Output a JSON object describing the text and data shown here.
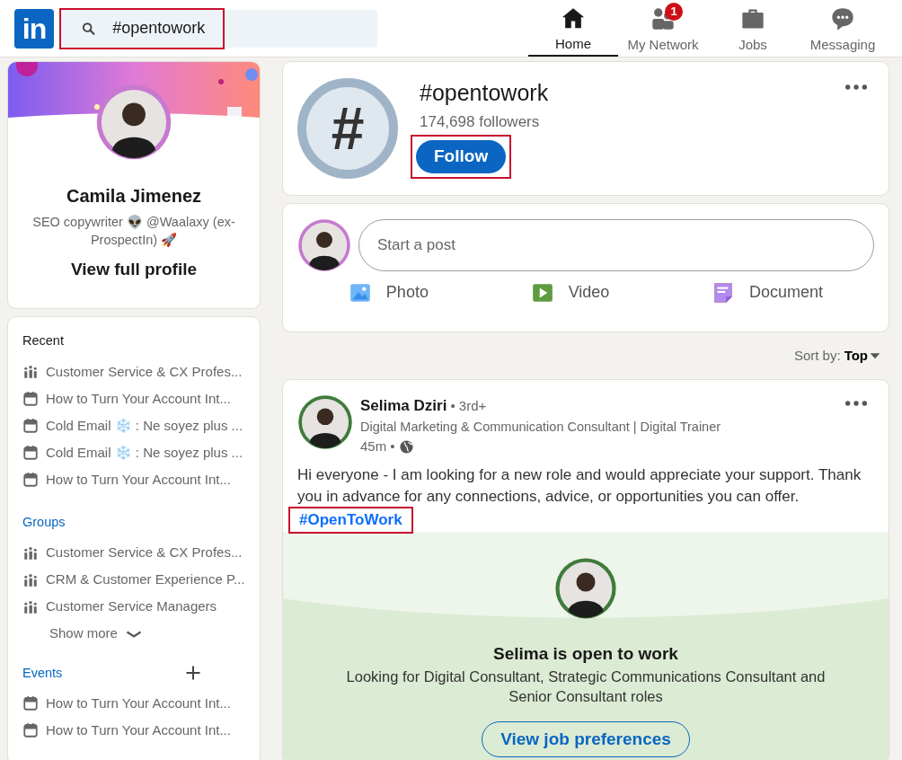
{
  "header": {
    "logo": "in",
    "search": {
      "value": "#opentowork",
      "highlighted": true
    },
    "nav": [
      {
        "kind": "home",
        "label": "Home",
        "selected": true
      },
      {
        "kind": "network",
        "label": "My Network",
        "selected": false,
        "badge": "1"
      },
      {
        "kind": "jobs",
        "label": "Jobs",
        "selected": false
      },
      {
        "kind": "messaging",
        "label": "Messaging",
        "selected": false
      }
    ]
  },
  "profile": {
    "name": "Camila Jimenez",
    "headline": "SEO copywriter 👽 @Waalaxy (ex-ProspectIn) 🚀",
    "link": "View full profile"
  },
  "sidebar": {
    "recent": {
      "title": "Recent",
      "items": [
        {
          "kind": "group",
          "label": "Customer Service & CX Profes..."
        },
        {
          "kind": "event",
          "label": "How to Turn Your Account Int..."
        },
        {
          "kind": "event",
          "label": "Cold Email ❄️ : Ne soyez plus ..."
        },
        {
          "kind": "event",
          "label": "Cold Email ❄️ : Ne soyez plus ..."
        },
        {
          "kind": "event",
          "label": "How to Turn Your Account Int..."
        }
      ]
    },
    "groups": {
      "title": "Groups",
      "items": [
        {
          "kind": "group",
          "label": "Customer Service & CX Profes..."
        },
        {
          "kind": "group",
          "label": "CRM & Customer Experience P..."
        },
        {
          "kind": "group",
          "label": "Customer Service Managers"
        }
      ],
      "show_more": "Show more"
    },
    "events": {
      "title": "Events",
      "items": [
        {
          "kind": "event",
          "label": "How to Turn Your Account Int..."
        },
        {
          "kind": "event",
          "label": "How to Turn Your Account Int..."
        }
      ]
    }
  },
  "hashtag": {
    "symbol": "#",
    "name": "#opentowork",
    "followers": "174,698 followers",
    "follow": {
      "label": "Follow",
      "highlighted": true
    }
  },
  "composer": {
    "placeholder": "Start a post",
    "actions": [
      {
        "label": "Photo"
      },
      {
        "kind": "video",
        "label": "Video"
      },
      {
        "kind": "document",
        "label": "Document"
      }
    ]
  },
  "sort": {
    "label": "Sort by:",
    "value": "Top"
  },
  "post": {
    "author": "Selima Dziri",
    "degree": "• 3rd+",
    "headline": "Digital Marketing & Communication Consultant | Digital Trainer",
    "time": "45m •",
    "body": "Hi everyone - I am looking for a new role and would appreciate your support. Thank you in advance for any connections, advice, or opportunities you can offer.",
    "hashtag": {
      "label": "#OpenToWork",
      "highlighted": true
    },
    "open_to_work": {
      "title": "Selima is open to work",
      "description": "Looking for Digital Consultant, Strategic Communications Consultant and Senior Consultant roles",
      "button": "View job preferences"
    }
  }
}
